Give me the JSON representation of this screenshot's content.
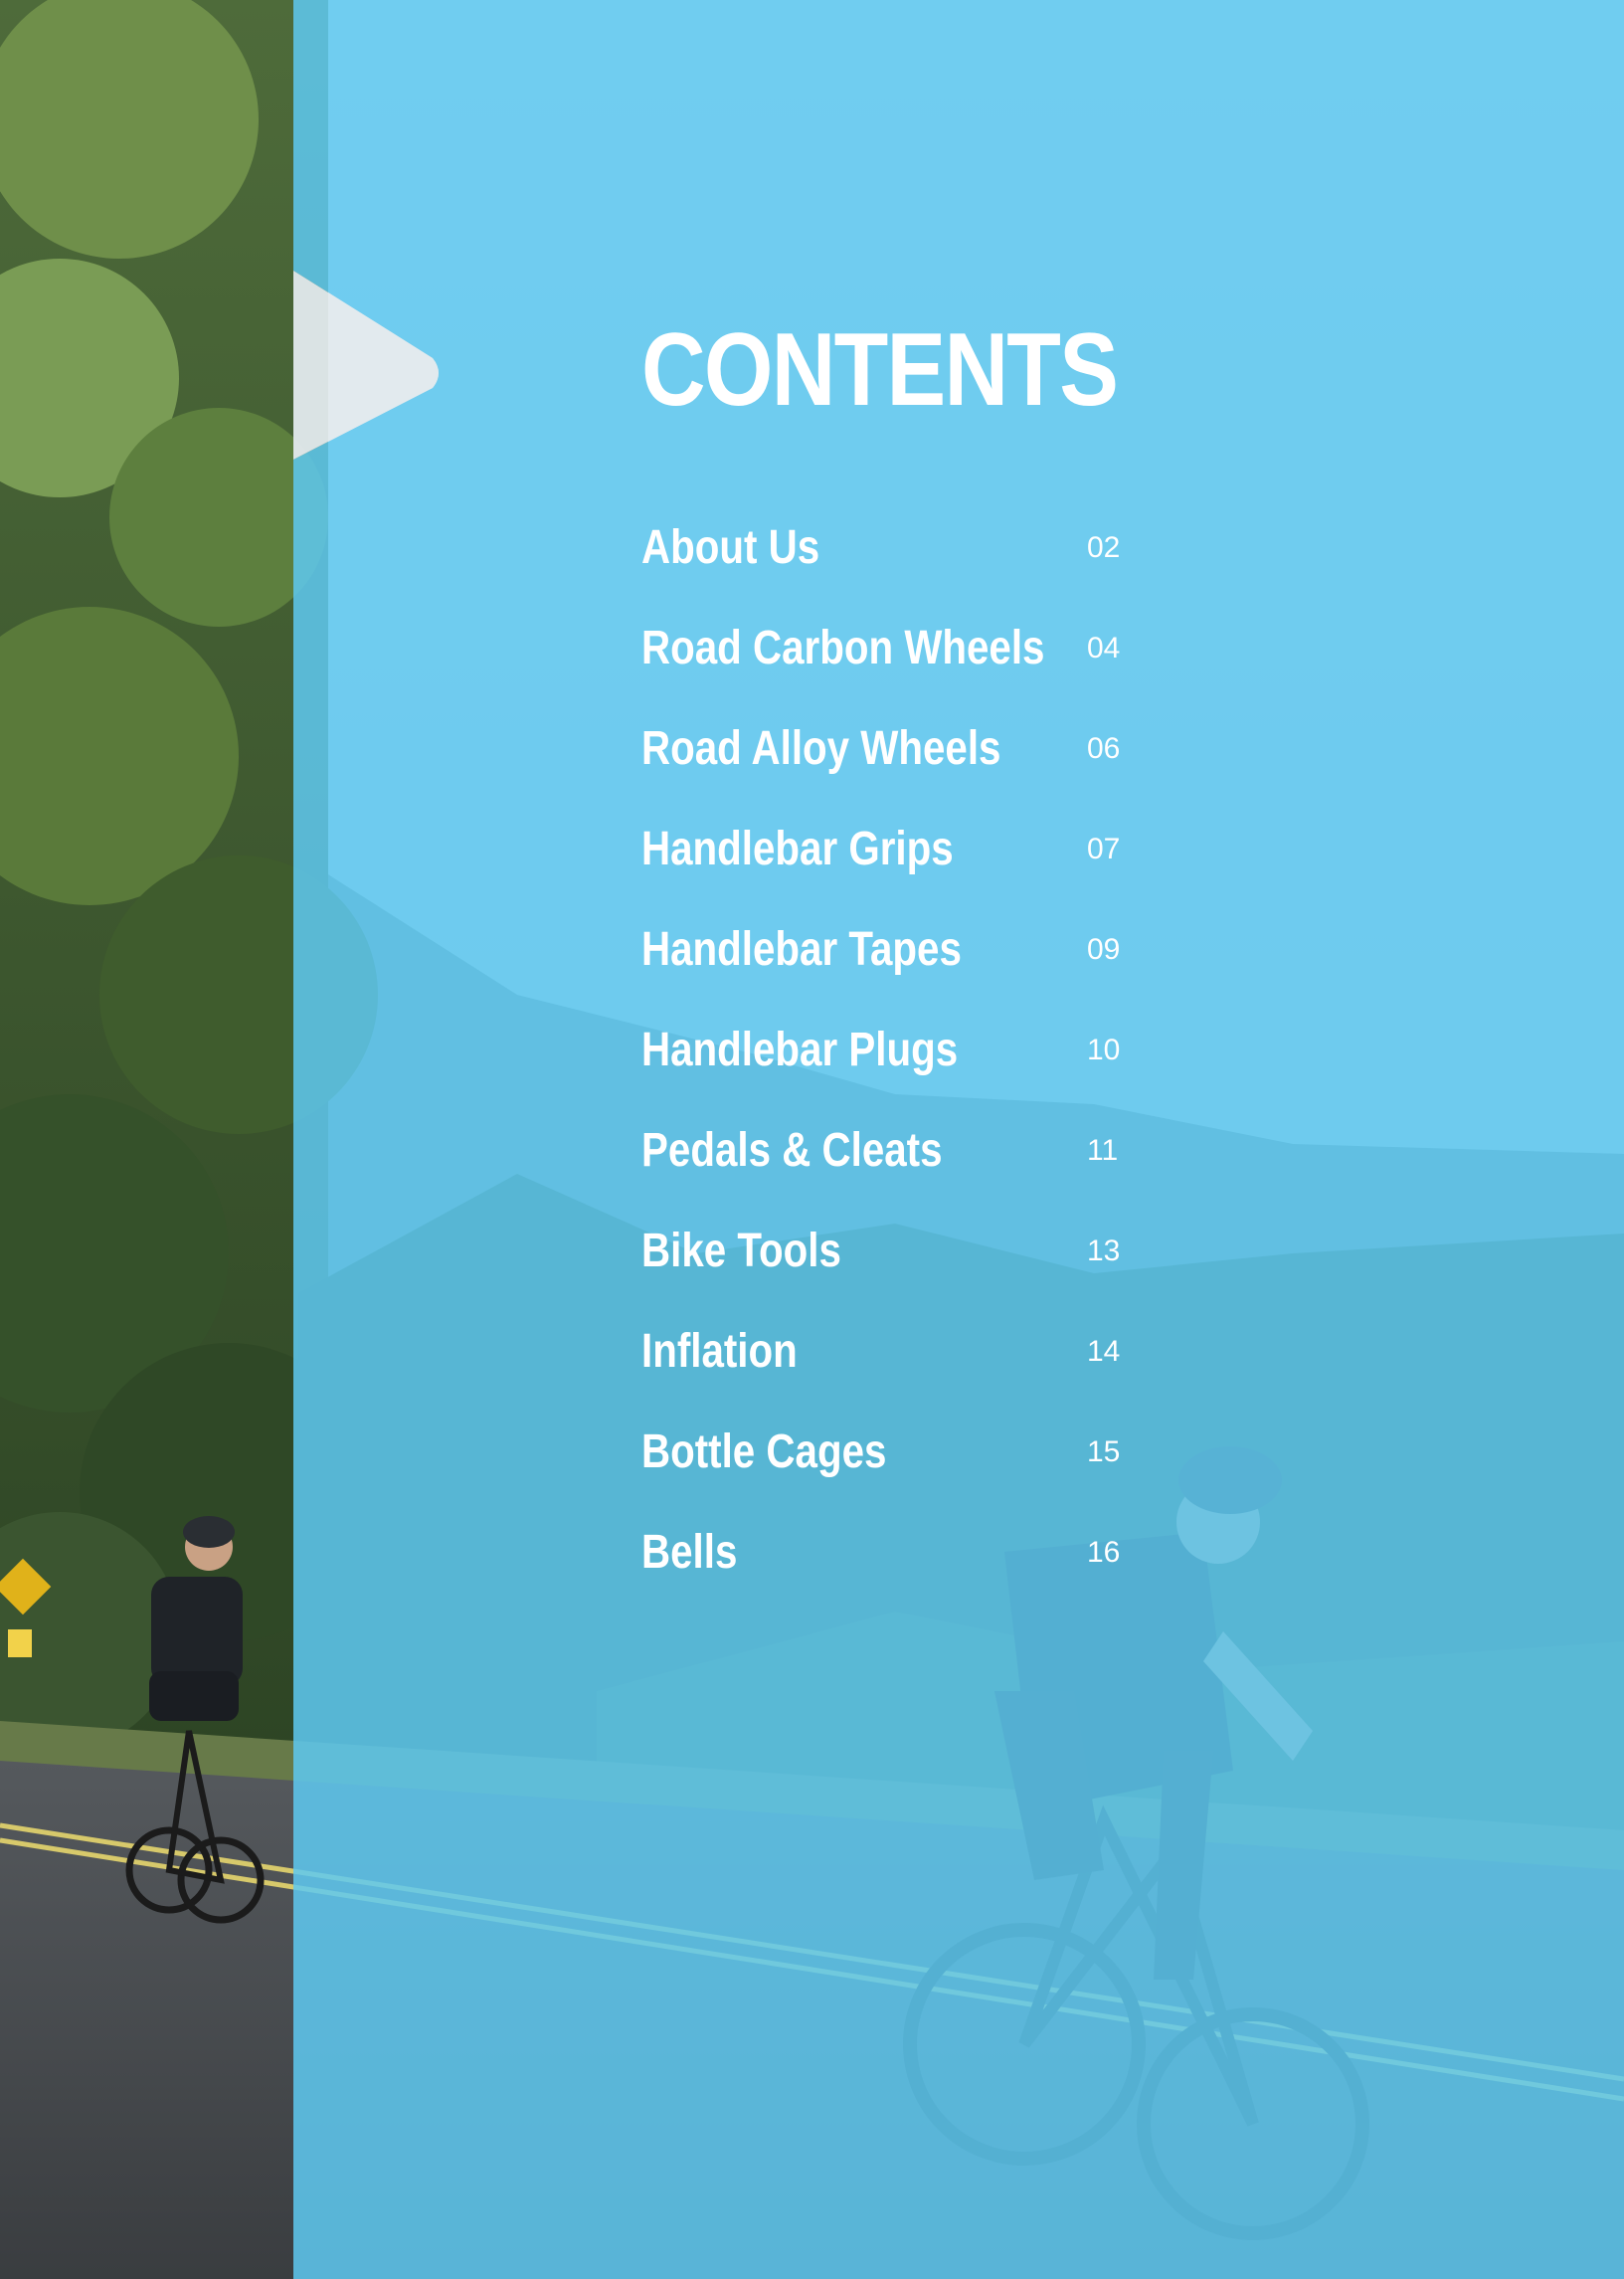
{
  "colors": {
    "overlay": "#5ec8f0",
    "text": "#ffffff"
  },
  "contents": {
    "title": "CONTENTS",
    "entries": [
      {
        "label": "About Us",
        "page": "02"
      },
      {
        "label": "Road Carbon Wheels",
        "page": "04"
      },
      {
        "label": "Road Alloy Wheels",
        "page": "06"
      },
      {
        "label": "Handlebar Grips",
        "page": "07"
      },
      {
        "label": "Handlebar Tapes",
        "page": "09"
      },
      {
        "label": "Handlebar Plugs",
        "page": "10"
      },
      {
        "label": "Pedals & Cleats",
        "page": "11"
      },
      {
        "label": "Bike Tools",
        "page": "13"
      },
      {
        "label": "Inflation",
        "page": "14"
      },
      {
        "label": "Bottle Cages",
        "page": "15"
      },
      {
        "label": "Bells",
        "page": "16"
      }
    ]
  }
}
